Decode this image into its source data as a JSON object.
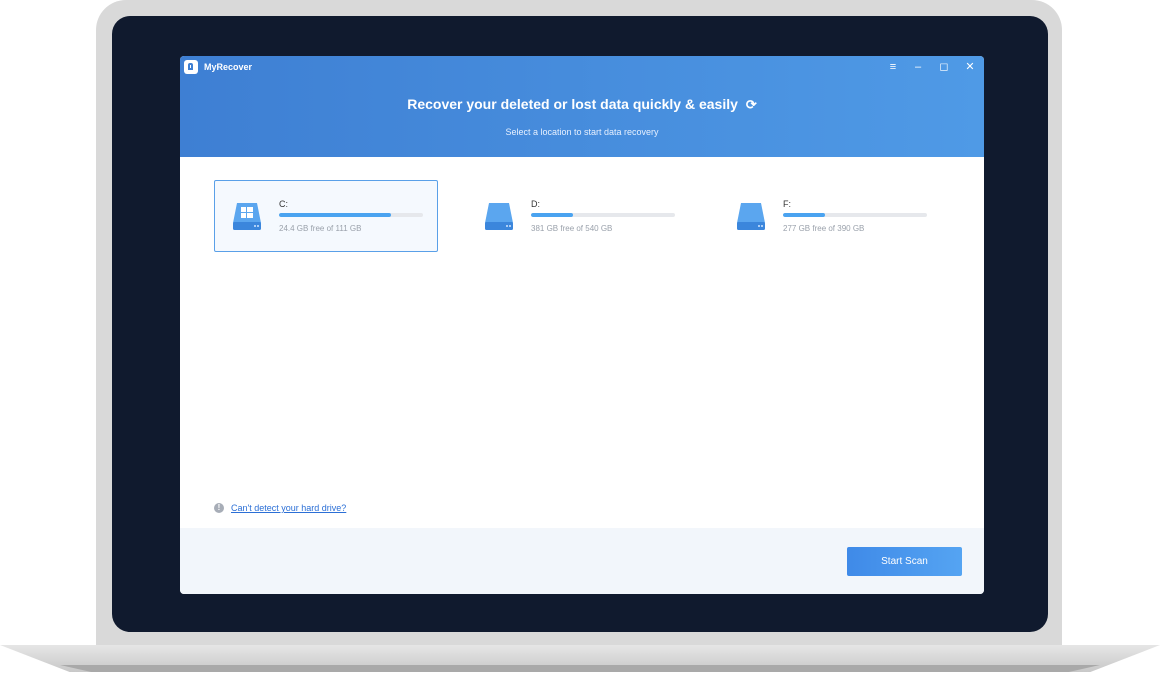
{
  "app": {
    "name": "MyRecover",
    "title": "Recover your deleted or lost data quickly & easily",
    "subtitle": "Select a location to start data recovery",
    "window_controls": [
      "menu-icon",
      "minimize-icon",
      "maximize-icon",
      "close-icon"
    ]
  },
  "drives": [
    {
      "label": "C:",
      "info": "24.4 GB free of 111 GB",
      "used_fraction": 0.78,
      "selected": true,
      "icon": "windows-drive-icon"
    },
    {
      "label": "D:",
      "info": "381 GB free of 540 GB",
      "used_fraction": 0.29,
      "selected": false,
      "icon": "drive-icon"
    },
    {
      "label": "F:",
      "info": "277 GB free of 390 GB",
      "used_fraction": 0.29,
      "selected": false,
      "icon": "drive-icon"
    }
  ],
  "help": {
    "link_text": "Can't detect your hard drive?",
    "icon": "info-icon"
  },
  "footer": {
    "scan_label": "Start Scan"
  },
  "colors": {
    "accent": "#3e7fd3",
    "bar": "#4aa3f0",
    "link": "#2b6fd6"
  }
}
